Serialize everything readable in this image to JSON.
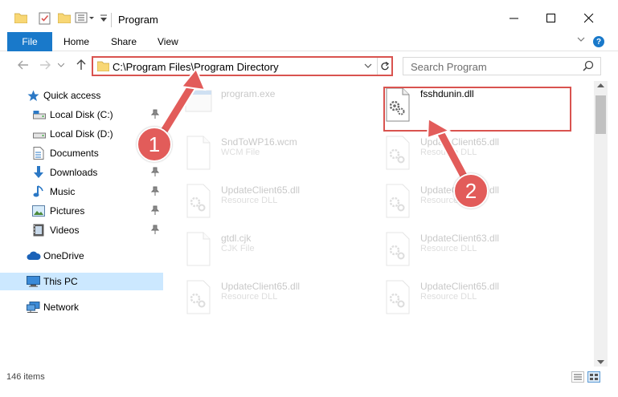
{
  "window": {
    "title": "Program",
    "minimize_icon": "minimize-icon",
    "maximize_icon": "maximize-icon",
    "close_icon": "close-icon"
  },
  "ribbon": {
    "tabs": [
      "File",
      "Home",
      "Share",
      "View"
    ],
    "help_label": "?"
  },
  "address_bar": {
    "path": "C:\\Program Files\\Program Directory"
  },
  "search": {
    "placeholder": "Search Program"
  },
  "sidebar": {
    "items": [
      {
        "label": "Quick access",
        "icon": "star-icon",
        "pinned": false
      },
      {
        "label": "Local Disk (C:)",
        "icon": "drive-icon",
        "pinned": true
      },
      {
        "label": "Local Disk (D:)",
        "icon": "drive-icon",
        "pinned": false
      },
      {
        "label": "Documents",
        "icon": "documents-icon",
        "pinned": false
      },
      {
        "label": "Downloads",
        "icon": "download-icon",
        "pinned": true
      },
      {
        "label": "Music",
        "icon": "music-icon",
        "pinned": true
      },
      {
        "label": "Pictures",
        "icon": "pictures-icon",
        "pinned": true
      },
      {
        "label": "Videos",
        "icon": "videos-icon",
        "pinned": true
      },
      {
        "label": "OneDrive",
        "icon": "cloud-icon",
        "pinned": false
      },
      {
        "label": "This PC",
        "icon": "computer-icon",
        "pinned": false,
        "selected": true
      },
      {
        "label": "Network",
        "icon": "network-icon",
        "pinned": false
      }
    ]
  },
  "files": [
    {
      "name": "program.exe",
      "type": "",
      "faded": true
    },
    {
      "name": "fsshdunin.dll",
      "type": "",
      "faded": false,
      "highlighted": true
    },
    {
      "name": "SndToWP16.wcm",
      "type": "WCM File",
      "faded": true
    },
    {
      "name": "UpdateClient65.dll",
      "type": "Resource DLL",
      "faded": true
    },
    {
      "name": "UpdateClient65.dll",
      "type": "Resource DLL",
      "faded": true
    },
    {
      "name": "UpdateClient65.dll",
      "type": "Resource DLL",
      "faded": true
    },
    {
      "name": "gtdl.cjk",
      "type": "CJK File",
      "faded": true
    },
    {
      "name": "UpdateClient63.dll",
      "type": "Resource DLL",
      "faded": true
    },
    {
      "name": "UpdateClient65.dll",
      "type": "Resource DLL",
      "faded": true
    },
    {
      "name": "UpdateClient65.dll",
      "type": "Resource DLL",
      "faded": true
    }
  ],
  "status": {
    "item_count": "146 items"
  },
  "annotations": {
    "step1": "1",
    "step2": "2",
    "color": "#e25c5a"
  },
  "colors": {
    "accent": "#1979ca",
    "selection": "#cce8ff",
    "highlight": "#d9534f"
  }
}
